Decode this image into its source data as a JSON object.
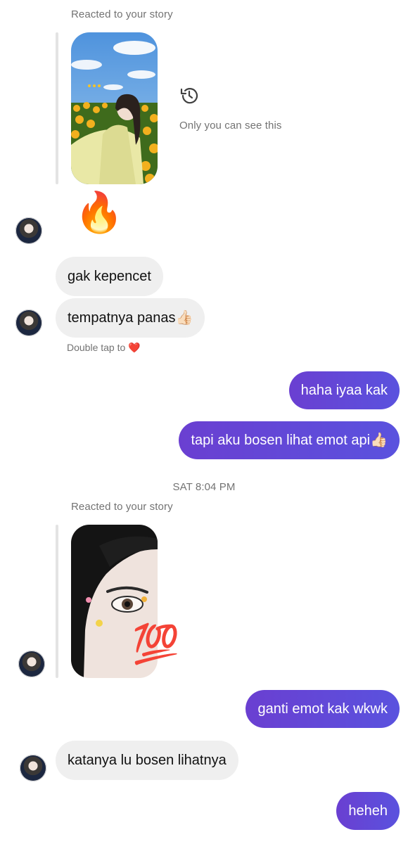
{
  "thread": {
    "story_reply_1": {
      "label": "Reacted to your story",
      "note": "Only you can see this",
      "reaction_emoji": "🔥"
    },
    "messages_in_1": [
      {
        "text": "gak kepencet"
      },
      {
        "text": "tempatnya panas👍🏻"
      }
    ],
    "double_tap_hint": "Double tap to",
    "double_tap_heart": "❤️",
    "messages_out_1": [
      {
        "text": "haha iyaa kak"
      },
      {
        "text": "tapi aku bosen lihat emot api👍🏻"
      }
    ],
    "timestamp": "SAT 8:04 PM",
    "story_reply_2": {
      "label": "Reacted to your story",
      "reaction_emoji": "💯"
    },
    "message_out_2": {
      "text": "ganti emot kak wkwk"
    },
    "message_in_2": {
      "text": "katanya lu bosen lihatnya"
    },
    "message_out_3": {
      "text": "heheh"
    }
  },
  "colors": {
    "outgoing_bubble": "#6247d8",
    "incoming_bubble": "#efefef",
    "meta_text": "#737373"
  }
}
